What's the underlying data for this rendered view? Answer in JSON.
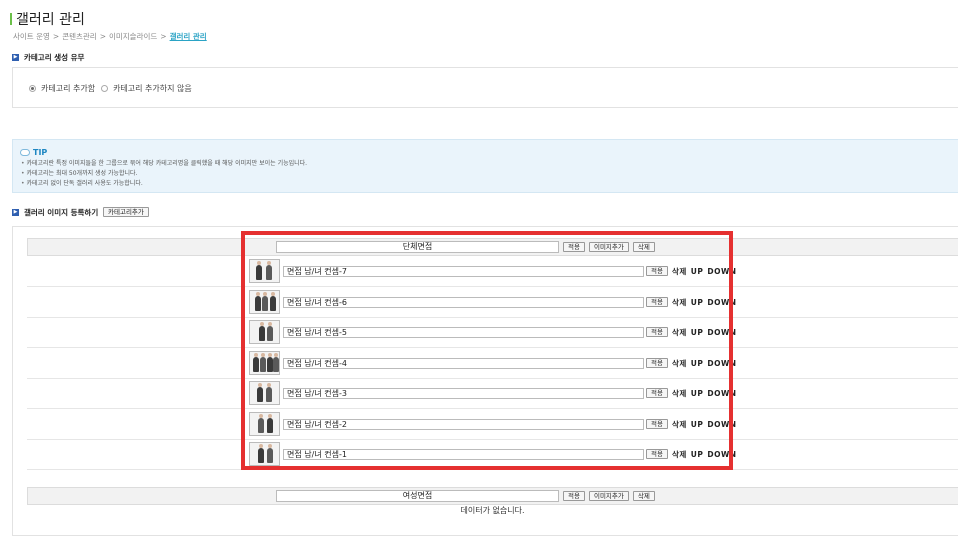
{
  "header": {
    "title": "갤러리 관리",
    "breadcrumb": [
      "사이트 운영",
      "콘텐츠관리",
      "이미지슬라이드",
      "갤러리 관리"
    ],
    "separator": ">"
  },
  "category_section": {
    "heading": "카테고리 생성 유무",
    "options": [
      {
        "label": "카테고리 추가함",
        "selected": true
      },
      {
        "label": "카테고리 추가하지 않음",
        "selected": false
      }
    ]
  },
  "tip": {
    "title": "TIP",
    "lines": [
      "카테고리란 특정 이미지들을 한 그룹으로 묶어 해당 카테고리명을 클릭했을 때 해당 이미지만 보이는 기능입니다.",
      "카테고리는 최대 50개까지 생성 가능합니다.",
      "카테고리 없이 단독 갤러리 사용도 가능합니다."
    ]
  },
  "register_section": {
    "heading": "갤러리 이미지 등록하기",
    "add_category_button": "카테고리추가"
  },
  "group_buttons": {
    "apply": "적용",
    "add_image": "이미지추가",
    "delete": "삭제"
  },
  "row_buttons": {
    "apply": "적용",
    "delete": "삭제",
    "up": "UP",
    "down": "DOWN"
  },
  "groups": [
    {
      "name": "단체면접",
      "images": [
        {
          "title": "면접 남/녀 컨셉-7"
        },
        {
          "title": "면접 남/녀 컨셉-6"
        },
        {
          "title": "면접 남/녀 컨셉-5"
        },
        {
          "title": "면접 남/녀 컨셉-4"
        },
        {
          "title": "면접 남/녀 컨셉-3"
        },
        {
          "title": "면접 남/녀 컨셉-2"
        },
        {
          "title": "면접 남/녀 컨셉-1"
        }
      ]
    },
    {
      "name": "여성면접",
      "images": [],
      "empty_message": "데이터가 없습니다."
    }
  ],
  "colors": {
    "highlight": "#e53030",
    "accent": "#2aa3c5",
    "tip_bg": "#eaf4fb"
  }
}
